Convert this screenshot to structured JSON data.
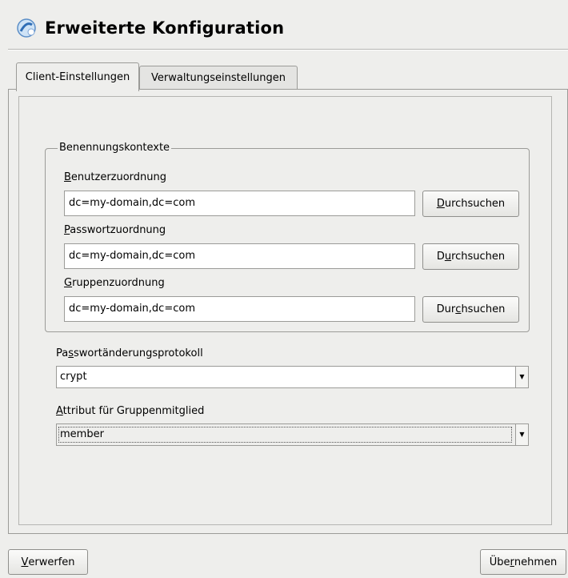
{
  "header": {
    "title": "Erweiterte Konfiguration",
    "icon": "config-wizard-icon"
  },
  "tabs": [
    {
      "label": "Client-Einstellungen",
      "active": true
    },
    {
      "label": "Verwaltungseinstellungen",
      "active": false
    }
  ],
  "naming_contexts": {
    "legend": "Benennungskontexte",
    "user": {
      "label_mnemonic": "B",
      "label_rest": "enutzerzuordnung",
      "value": "dc=my-domain,dc=com"
    },
    "password": {
      "label_mnemonic": "P",
      "label_rest": "asswortzuordnung",
      "value": "dc=my-domain,dc=com"
    },
    "group": {
      "label_mnemonic": "G",
      "label_rest": "ruppenzuordnung",
      "value": "dc=my-domain,dc=com"
    },
    "browse_buttons": [
      {
        "pre": "",
        "mnemonic": "D",
        "post": "urchsuchen"
      },
      {
        "pre": "D",
        "mnemonic": "u",
        "post": "rchsuchen"
      },
      {
        "pre": "Dur",
        "mnemonic": "c",
        "post": "hsuchen"
      }
    ]
  },
  "password_protocol": {
    "label_pre": "Pa",
    "label_mnemonic": "s",
    "label_post": "swortänderungsprotokoll",
    "value": "crypt"
  },
  "group_member_attr": {
    "label_mnemonic": "A",
    "label_rest": "ttribut für Gruppenmitglied",
    "value": "member"
  },
  "footer": {
    "discard": {
      "mnemonic": "V",
      "rest": "erwerfen"
    },
    "apply": {
      "pre": "Übe",
      "mnemonic": "r",
      "post": "nehmen"
    }
  }
}
